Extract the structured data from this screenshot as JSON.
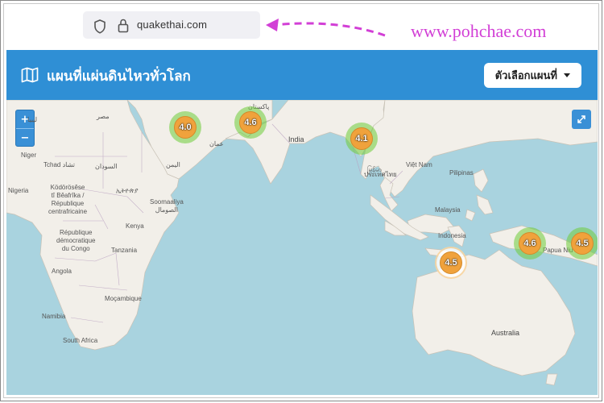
{
  "browser": {
    "url": "quakethai.com",
    "watermark": "www.pohchae.com"
  },
  "header": {
    "title": "แผนที่แผ่นดินไหวทั่วโลก",
    "options_label": "ตัวเลือกแผนที่"
  },
  "map": {
    "zoom_in": "+",
    "zoom_out": "−",
    "labels": {
      "libya": "ليبيا",
      "egypt": "مصر",
      "niger": "Niger",
      "tchad": "Tchad تشاد",
      "sudan": "السودان",
      "yemen": "اليمن",
      "oman": "عمان",
      "pakistan": "پاکستان",
      "india": "India",
      "nigeria": "Nigeria",
      "car": "Ködörösêse\ntî Bêafrîka /\nRépublique\ncentrafricaine",
      "ethiopia": "ኢትዮጵያ",
      "somalia": "Soomaaliya\nالصومال",
      "kenya": "Kenya",
      "drc": "République\ndémocratique\ndu Congo",
      "tanzania": "Tanzania",
      "angola": "Angola",
      "mocambique": "Moçambique",
      "namibia": "Namibia",
      "south_africa": "South Africa",
      "myanmar": "မြန်မာ",
      "thailand": "ประเทศไทย",
      "vietnam": "Việt Nam",
      "pilipinas": "Pilipinas",
      "malaysia": "Malaysia",
      "indonesia": "Indonesia",
      "png": "Papua Niu",
      "australia": "Australia"
    },
    "clusters": [
      {
        "id": "arabia",
        "magnitude": "4.0"
      },
      {
        "id": "pakistan",
        "magnitude": "4.6"
      },
      {
        "id": "myanmar",
        "magnitude": "4.1"
      },
      {
        "id": "indonesia",
        "magnitude": "4.5"
      },
      {
        "id": "papua",
        "magnitude": "4.6"
      },
      {
        "id": "papua-east",
        "magnitude": "4.5"
      }
    ]
  },
  "colors": {
    "header_bg": "#2f8fd5",
    "watermark": "#d23fd6",
    "cluster_outer": "#6ecc39",
    "cluster_core": "#f0a23c",
    "sea": "#a9d3df",
    "land": "#f2efe9"
  }
}
